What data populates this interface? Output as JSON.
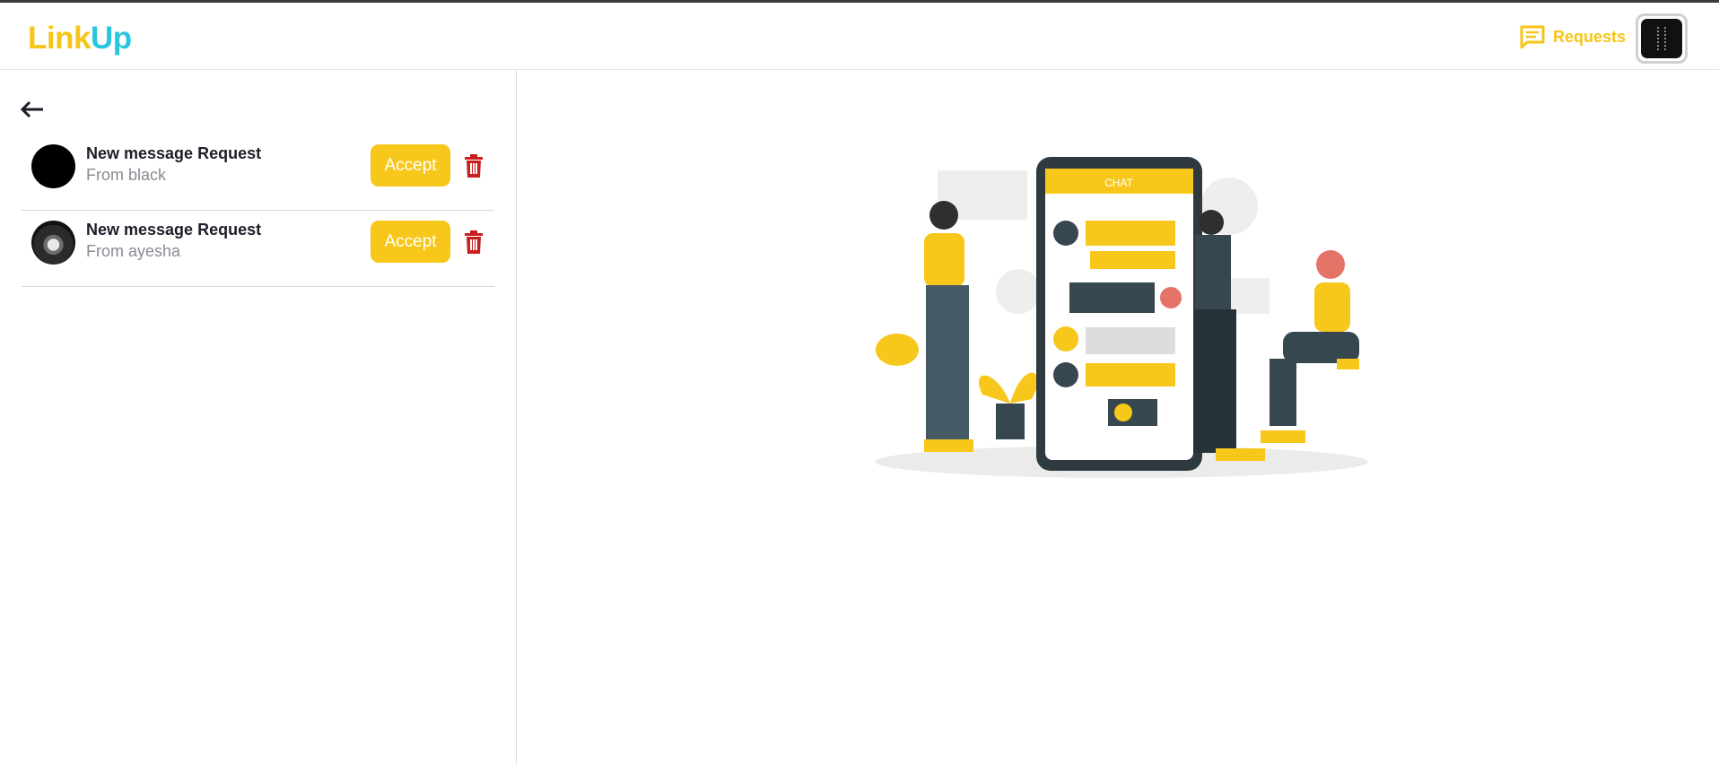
{
  "header": {
    "logo_part1": "Link",
    "logo_part2": "Up",
    "requests_label": "Requests",
    "requests_icon": "chat-bubble-icon"
  },
  "sidebar": {
    "back_icon": "arrow-left-icon",
    "requests": [
      {
        "title": "New message Request",
        "from": "From black",
        "accept_label": "Accept",
        "delete_icon": "trash-icon"
      },
      {
        "title": "New message Request",
        "from": "From ayesha",
        "accept_label": "Accept",
        "delete_icon": "trash-icon"
      }
    ]
  },
  "illustration": {
    "phone_header": "CHAT"
  },
  "colors": {
    "accent_yellow": "#f7c71b",
    "logo_cyan": "#29c6e0",
    "delete_red": "#c81e1e"
  }
}
